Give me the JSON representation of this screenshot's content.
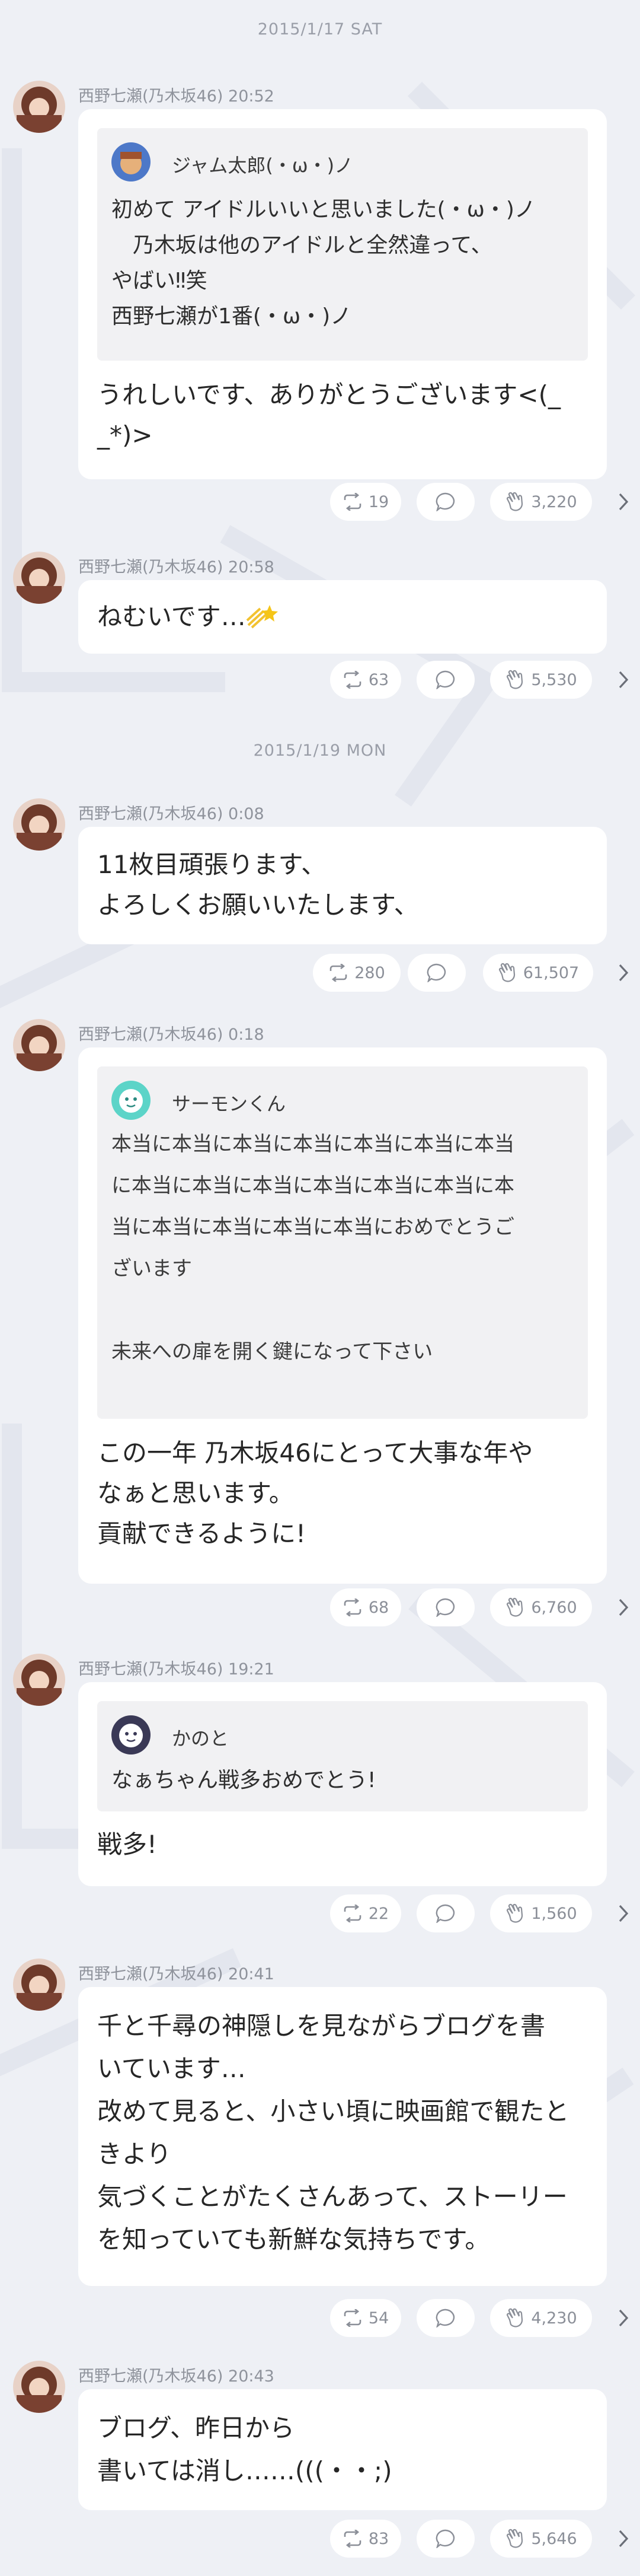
{
  "dates": [
    "2015/1/17 SAT",
    "2015/1/19 MON"
  ],
  "messages": [
    {
      "author": "西野七瀬(乃木坂46)",
      "time": "20:52",
      "quote": {
        "name": "ジャム太郎(・ω・)ノ",
        "lines": [
          "初めて アイドルいいと思いました(・ω・)ノ",
          "　乃木坂は他のアイドルと全然違って、",
          "やばい‼︎笑",
          "西野七瀬が1番(・ω・)ノ"
        ]
      },
      "text": [
        "うれしいです、ありがとうございます<(_",
        "_*)>"
      ],
      "retweets": "19",
      "claps": "3,220"
    },
    {
      "author": "西野七瀬(乃木坂46)",
      "time": "20:58",
      "text": [
        "ねむいです…"
      ],
      "retweets": "63",
      "claps": "5,530"
    },
    {
      "author": "西野七瀬(乃木坂46)",
      "time": "0:08",
      "text": [
        "11枚目頑張ります、",
        "よろしくお願いいたします、"
      ],
      "retweets": "280",
      "claps": "61,507"
    },
    {
      "author": "西野七瀬(乃木坂46)",
      "time": "0:18",
      "quote": {
        "name": "サーモンくん",
        "lines": [
          "本当に本当に本当に本当に本当に本当に本当",
          "に本当に本当に本当に本当に本当に本当に本",
          "当に本当に本当に本当に本当におめでとうご",
          "ざいます",
          "",
          "未来への扉を開く鍵になって下さい"
        ]
      },
      "text": [
        "この一年 乃木坂46にとって大事な年や",
        "なぁと思います。",
        "貢献できるように!"
      ],
      "retweets": "68",
      "claps": "6,760"
    },
    {
      "author": "西野七瀬(乃木坂46)",
      "time": "19:21",
      "quote": {
        "name": "かのと",
        "lines": [
          "なぁちゃん戦多おめでとう!"
        ]
      },
      "text": [
        "戦多!"
      ],
      "retweets": "22",
      "claps": "1,560"
    },
    {
      "author": "西野七瀬(乃木坂46)",
      "time": "20:41",
      "text": [
        "千と千尋の神隠しを見ながらブログを書",
        "いています…",
        "改めて見ると、小さい頃に映画館で観たと",
        "きより",
        "気づくことがたくさんあって、ストーリー",
        "を知っていても新鮮な気持ちです。"
      ],
      "retweets": "54",
      "claps": "4,230"
    },
    {
      "author": "西野七瀬(乃木坂46)",
      "time": "20:43",
      "text": [
        "ブログ、昨日から",
        "書いては消し……(((・・;)"
      ],
      "retweets": "83",
      "claps": "5,646"
    }
  ],
  "colors": {
    "background": "#eef0f5",
    "bubble": "#ffffff",
    "quote": "#f1f1f3",
    "muted": "#8f939c"
  }
}
